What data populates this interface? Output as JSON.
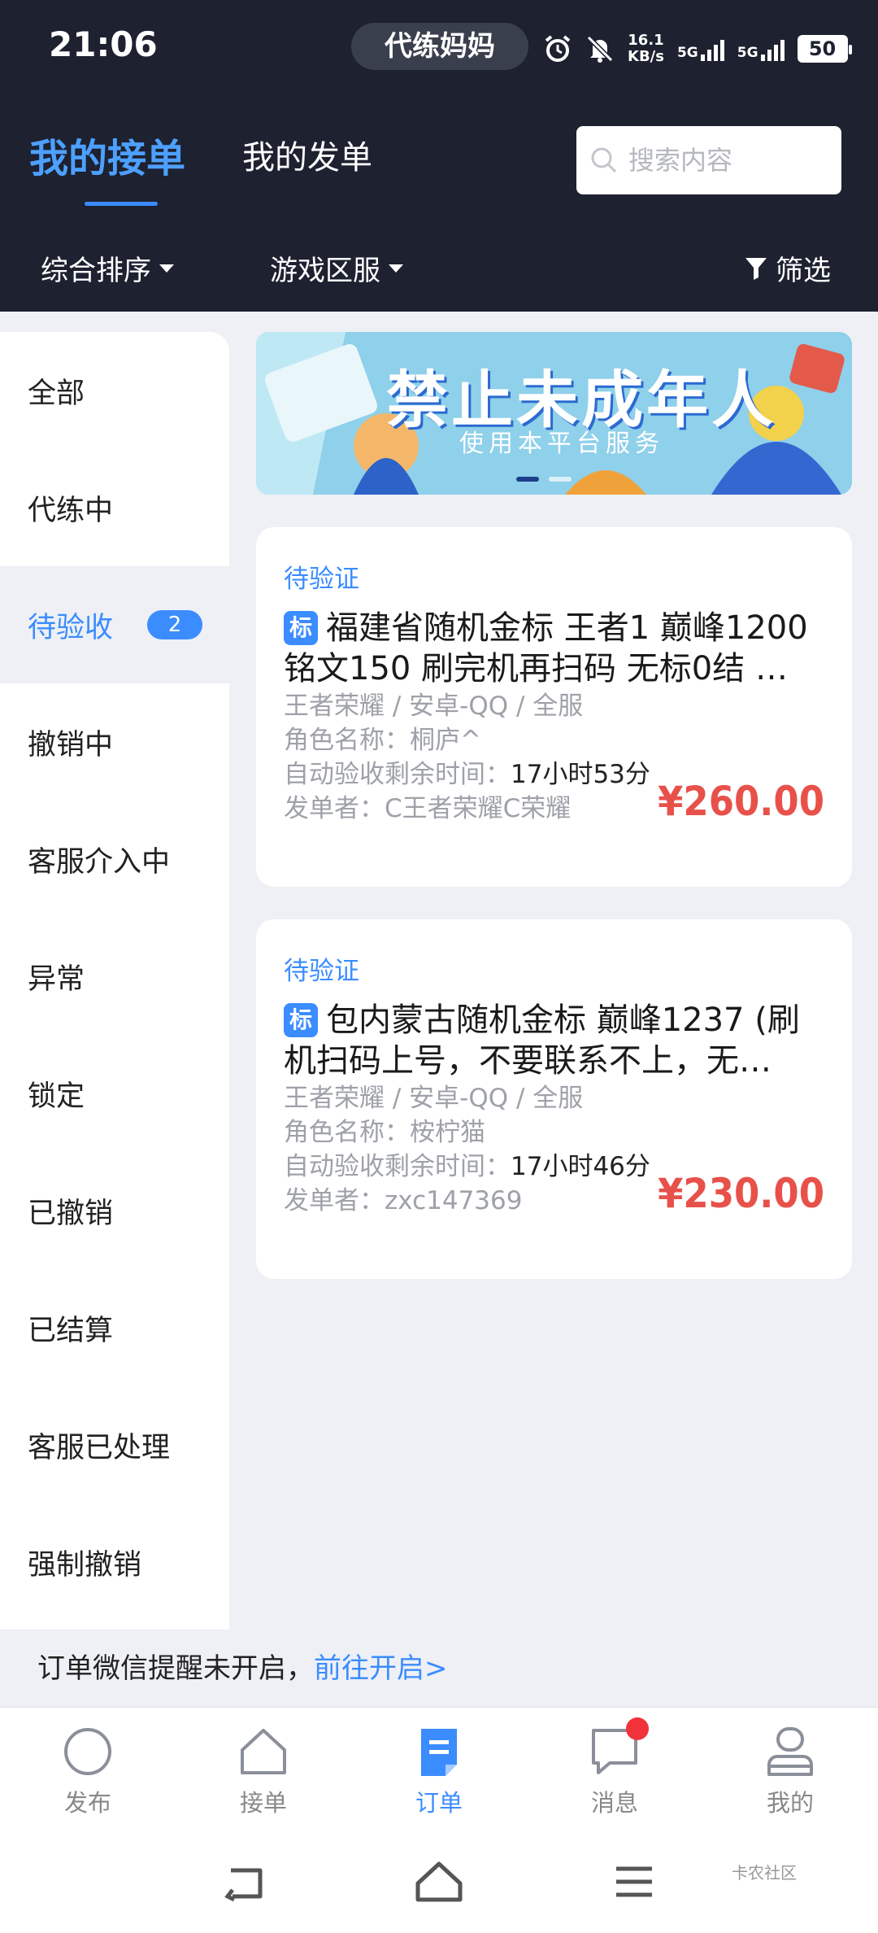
{
  "status_bar": {
    "time": "21:06",
    "app_pill": "代练妈妈",
    "speed_value": "16.1",
    "speed_unit": "KB/s",
    "sim1": "5G",
    "sim2": "5G",
    "battery": "50"
  },
  "header": {
    "tabs": [
      {
        "label": "我的接单"
      },
      {
        "label": "我的发单"
      }
    ],
    "search_placeholder": "搜索内容",
    "filters": {
      "sort": "综合排序",
      "region": "游戏区服",
      "screen": "筛选"
    }
  },
  "sidebar": {
    "items": [
      {
        "label": "全部"
      },
      {
        "label": "代练中"
      },
      {
        "label": "待验收",
        "badge": "2"
      },
      {
        "label": "撤销中"
      },
      {
        "label": "客服介入中"
      },
      {
        "label": "异常"
      },
      {
        "label": "锁定"
      },
      {
        "label": "已撤销"
      },
      {
        "label": "已结算"
      },
      {
        "label": "客服已处理"
      },
      {
        "label": "强制撤销"
      }
    ]
  },
  "banner": {
    "title": "禁止未成年人",
    "subtitle": "使用本平台服务"
  },
  "orders": [
    {
      "status": "待验证",
      "tag": "标",
      "title": "福建省随机金标 王者1 巅峰1200 铭文150 刷完机再扫码 无标0结 …",
      "game": "王者荣耀 / 安卓-QQ / 全服",
      "role_label": "角色名称：",
      "role": "桐庐^",
      "time_label": "自动验收剩余时间：",
      "time": "17小时53分",
      "publisher_label": "发单者：",
      "publisher": "C王者荣耀C荣耀",
      "price": "¥260.00"
    },
    {
      "status": "待验证",
      "tag": "标",
      "title": "包内蒙古随机金标 巅峰1237 (刷机扫码上号，不要联系不上，无…",
      "game": "王者荣耀 / 安卓-QQ / 全服",
      "role_label": "角色名称：",
      "role": "桉柠猫",
      "time_label": "自动验收剩余时间：",
      "time": "17小时46分",
      "publisher_label": "发单者：",
      "publisher": "zxc147369",
      "price": "¥230.00"
    }
  ],
  "notice": {
    "text": "订单微信提醒未开启，",
    "link": "前往开启>"
  },
  "bottom_nav": [
    {
      "label": "发布",
      "icon": "circle-icon"
    },
    {
      "label": "接单",
      "icon": "home-icon"
    },
    {
      "label": "订单",
      "icon": "order-icon"
    },
    {
      "label": "消息",
      "icon": "message-icon"
    },
    {
      "label": "我的",
      "icon": "profile-icon"
    }
  ],
  "watermark": "卡农社区",
  "colors": {
    "accent": "#3b8cff",
    "header_bg": "#1d2130",
    "price": "#e8514a",
    "page_bg": "#eef0f5"
  }
}
